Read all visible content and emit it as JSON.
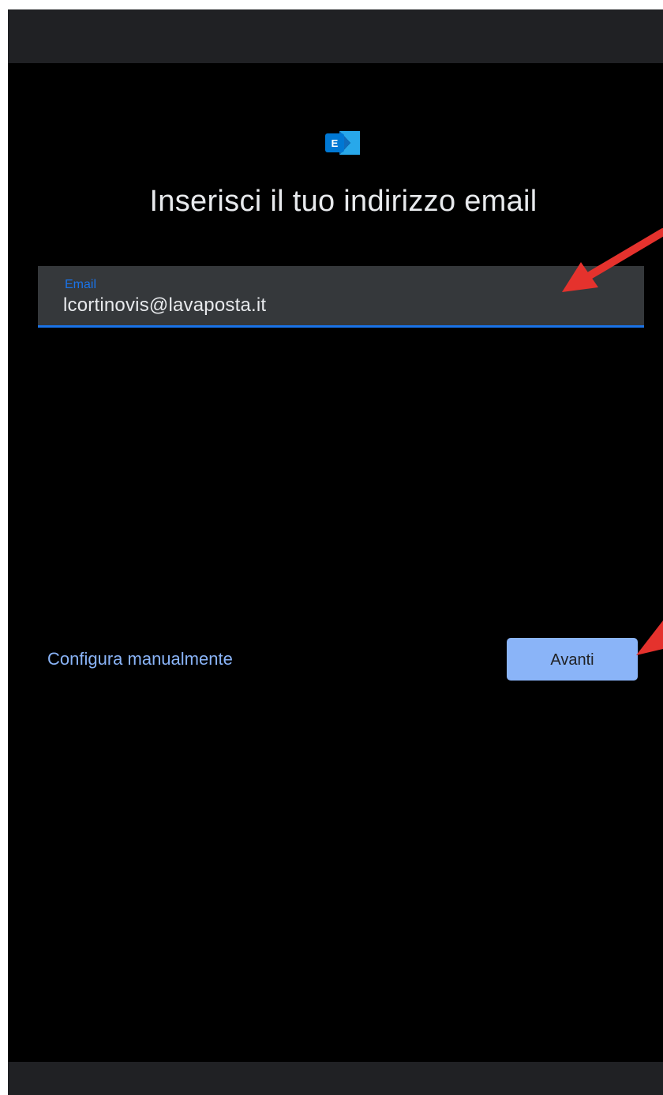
{
  "header": {
    "title": "Inserisci il tuo indirizzo email"
  },
  "logo": {
    "icon": "exchange-logo-icon",
    "letter": "E"
  },
  "email_field": {
    "label": "Email",
    "value": "lcortinovis@lavaposta.it"
  },
  "actions": {
    "manual_setup_label": "Configura manualmente",
    "next_label": "Avanti"
  },
  "annotations": {
    "arrow_color": "#e5322d"
  },
  "colors": {
    "background": "#000000",
    "accent": "#1a73e8",
    "link": "#8ab4f8",
    "button": "#8ab4f8",
    "field_bg": "#35383b"
  }
}
